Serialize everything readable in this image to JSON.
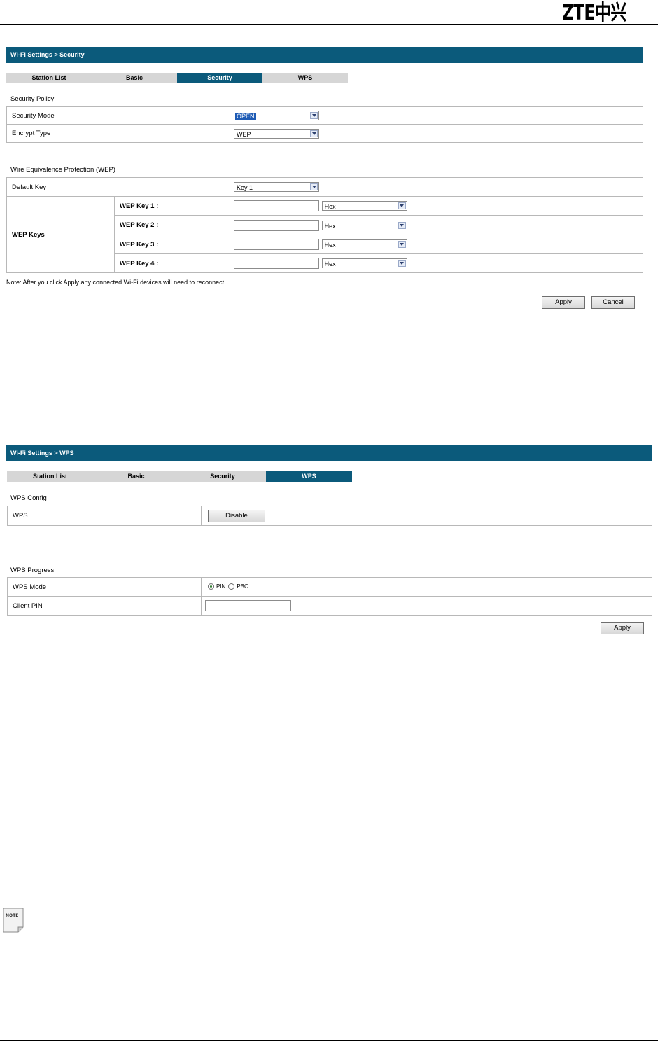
{
  "brand": {
    "logo_text": "ZTE中兴"
  },
  "security_panel": {
    "breadcrumb": "Wi-Fi Settings > Security",
    "tabs": [
      "Station List",
      "Basic",
      "Security",
      "WPS"
    ],
    "active_tab": "Security",
    "security_policy": {
      "section_title": "Security Policy",
      "security_mode_label": "Security Mode",
      "security_mode_value": "OPEN",
      "encrypt_type_label": "Encrypt Type",
      "encrypt_type_value": "WEP"
    },
    "wep": {
      "section_title": "Wire Equivalence Protection (WEP)",
      "default_key_label": "Default Key",
      "default_key_value": "Key 1",
      "wep_keys_label": "WEP Keys",
      "keys": [
        {
          "label": "WEP Key 1 :",
          "value": "",
          "format": "Hex"
        },
        {
          "label": "WEP Key 2 :",
          "value": "",
          "format": "Hex"
        },
        {
          "label": "WEP Key 3 :",
          "value": "",
          "format": "Hex"
        },
        {
          "label": "WEP Key 4 :",
          "value": "",
          "format": "Hex"
        }
      ]
    },
    "note": "Note: After you click Apply any connected Wi-Fi devices will need to reconnect.",
    "apply_label": "Apply",
    "cancel_label": "Cancel"
  },
  "wps_panel": {
    "breadcrumb": "Wi-Fi Settings > WPS",
    "tabs": [
      "Station List",
      "Basic",
      "Security",
      "WPS"
    ],
    "active_tab": "WPS",
    "wps_config": {
      "section_title": "WPS Config",
      "wps_label": "WPS",
      "disable_label": "Disable"
    },
    "wps_progress": {
      "section_title": "WPS Progress",
      "wps_mode_label": "WPS Mode",
      "mode_options": [
        "PIN",
        "PBC"
      ],
      "selected_mode": "PIN",
      "client_pin_label": "Client PIN",
      "client_pin_value": ""
    },
    "apply_label": "Apply"
  },
  "note_icon": {
    "text": "NOTE"
  }
}
